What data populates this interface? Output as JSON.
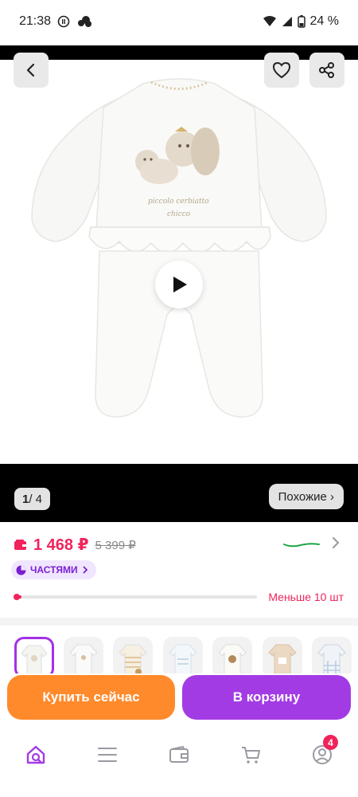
{
  "status_bar": {
    "time": "21:38",
    "battery": "24 %",
    "icons": [
      "pause-circle-icon",
      "cloud-icon",
      "wifi-icon",
      "signal-icon",
      "battery-icon"
    ]
  },
  "media": {
    "counter_current": "1",
    "counter_total": "/ 4",
    "similar_label": "Похожие ›",
    "icons": [
      "back-arrow-icon",
      "heart-icon",
      "share-icon",
      "play-icon"
    ]
  },
  "product": {
    "price": "1 468 ₽",
    "old_price": "5 399 ₽",
    "installments_label": "ЧАСТЯМИ",
    "stock_text": "Меньше 10 шт",
    "stock_fraction": 0.03
  },
  "thumbnails": {
    "count": 7,
    "active_index": 0
  },
  "actions": {
    "buy_now": "Купить сейчас",
    "add_to_cart": "В корзину"
  },
  "bottom_nav": {
    "items": [
      "home-search-icon",
      "catalog-icon",
      "wallet-icon",
      "cart-icon",
      "profile-icon"
    ],
    "profile_badge": "4"
  },
  "colors": {
    "accent_purple": "#a33be5",
    "buy_orange": "#ff8a2b",
    "price_pink": "#f0245b"
  }
}
